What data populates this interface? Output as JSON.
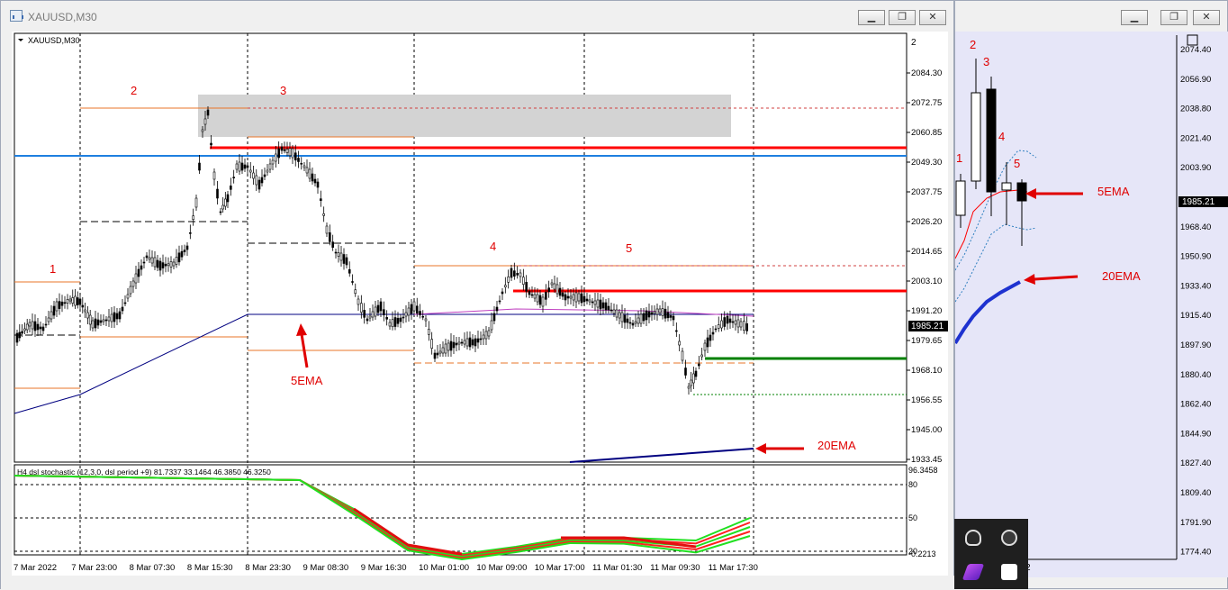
{
  "main_window": {
    "title": "XAUUSD,M30",
    "chart_label": "XAUUSD,M30",
    "buttons": {
      "minimize": "▁",
      "maximize": "❐",
      "close": "✕"
    }
  },
  "right_window": {
    "buttons": {
      "minimize": "▁",
      "maximize": "❐",
      "close": "✕"
    },
    "price_badge": "1985.21"
  },
  "main_chart": {
    "price_axis_top": "2",
    "price_ticks": [
      "2084.30",
      "2072.75",
      "2060.85",
      "2049.30",
      "2037.75",
      "2026.20",
      "2014.65",
      "2003.10",
      "1991.20",
      "1979.65",
      "1968.10",
      "1956.55",
      "1945.00",
      "1933.45"
    ],
    "current_price": "1985.21",
    "time_ticks": [
      "7 Mar 2022",
      "7 Mar 23:00",
      "8 Mar 07:30",
      "8 Mar 15:30",
      "8 Mar 23:30",
      "9 Mar 08:30",
      "9 Mar 16:30",
      "10 Mar 01:00",
      "10 Mar 09:00",
      "10 Mar 17:00",
      "11 Mar 01:30",
      "11 Mar 09:30",
      "11 Mar 17:30"
    ],
    "annotations": {
      "wave_1": "1",
      "wave_2": "2",
      "wave_3": "3",
      "wave_4": "4",
      "wave_5": "5",
      "ema5_label": "5EMA",
      "ema20_label": "20EMA"
    }
  },
  "indicator": {
    "header": "H4 dsl stochastic (12,3,0, dsl period +9) 81.7337 33.1464 46.3850 46.3250",
    "ticks": [
      "96.3458",
      "80",
      "50",
      "20",
      "-0.2213"
    ]
  },
  "right_chart": {
    "price_ticks": [
      "2074.40",
      "2056.90",
      "2038.80",
      "2021.40",
      "2003.90",
      "1985.21",
      "1968.40",
      "1950.90",
      "1933.40",
      "1915.40",
      "1897.90",
      "1880.40",
      "1862.40",
      "1844.90",
      "1827.40",
      "1809.40",
      "1791.90",
      "1774.40"
    ],
    "annotations": {
      "wave_1": "1",
      "wave_2": "2",
      "wave_3": "3",
      "wave_4": "4",
      "wave_5": "5",
      "ema5_label": "5EMA",
      "ema20_label": "20EMA"
    },
    "time_stub": "2"
  },
  "colors": {
    "red_level": "#ff0000",
    "blue_level": "#1e7fe0",
    "green_level": "#008000",
    "orange_level": "#e8742a",
    "ema_navy": "#000080",
    "zone_gray": "#d3d3d3",
    "right_bg": "#e6e6f8"
  }
}
